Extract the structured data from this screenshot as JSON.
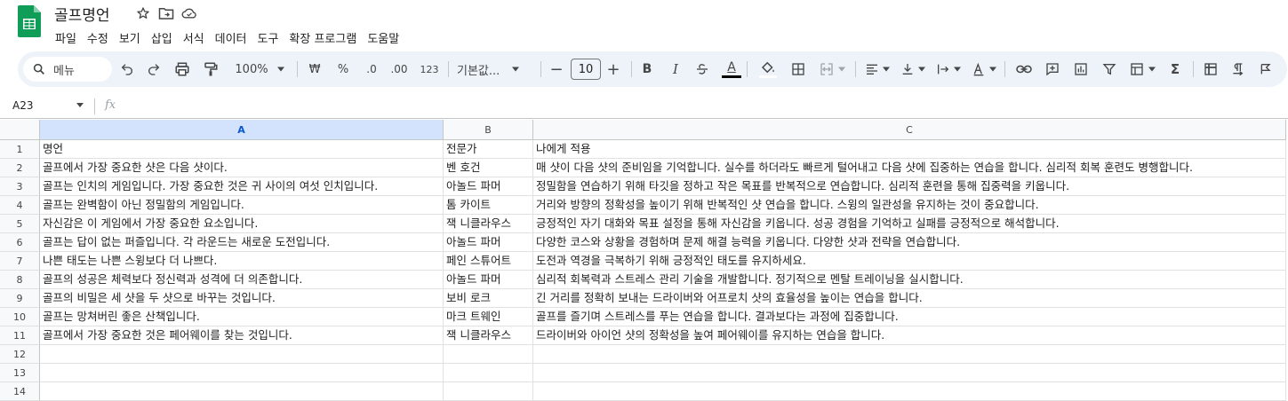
{
  "header": {
    "doc_title": "골프명언",
    "icons": [
      "star-icon",
      "move-to-folder-icon",
      "cloud-status-icon"
    ],
    "brand_color": "#0f9d58"
  },
  "menu": [
    "파일",
    "수정",
    "보기",
    "삽입",
    "서식",
    "데이터",
    "도구",
    "확장 프로그램",
    "도움말"
  ],
  "toolbar": {
    "search_label": "메뉴",
    "zoom": "100%",
    "currency": "₩",
    "percent": "%",
    "dec_decrease": ".0",
    "dec_increase": ".00",
    "number_format": "123",
    "font_name": "기본값...",
    "font_size": "10",
    "minus": "−",
    "plus": "+",
    "bold": "B",
    "italic": "I",
    "text_color": "A",
    "sum": "Σ"
  },
  "formula_bar": {
    "name_box": "A23",
    "fx": "fx"
  },
  "grid": {
    "columns": [
      "A",
      "B",
      "C"
    ],
    "selected_column": "A",
    "row_numbers": [
      "1",
      "2",
      "3",
      "4",
      "5",
      "6",
      "7",
      "8",
      "9",
      "10",
      "11",
      "12",
      "13",
      "14"
    ],
    "rows": [
      [
        "명언",
        "전문가",
        "나에게 적용"
      ],
      [
        "골프에서 가장 중요한 샷은 다음 샷이다.",
        "벤 호건",
        "매 샷이 다음 샷의 준비임을 기억합니다. 실수를 하더라도 빠르게 털어내고 다음 샷에 집중하는 연습을 합니다. 심리적 회복 훈련도 병행합니다."
      ],
      [
        "골프는 인치의 게임입니다. 가장 중요한 것은 귀 사이의 여섯 인치입니다.",
        "아놀드 파머",
        "정밀함을 연습하기 위해 타깃을 정하고 작은 목표를 반복적으로 연습합니다. 심리적 훈련을 통해 집중력을 키웁니다."
      ],
      [
        "골프는 완벽함이 아닌 정밀함의 게임입니다.",
        "톰 카이트",
        "거리와 방향의 정확성을 높이기 위해 반복적인 샷 연습을 합니다. 스윙의 일관성을 유지하는 것이 중요합니다."
      ],
      [
        "자신감은 이 게임에서 가장 중요한 요소입니다.",
        "잭 니클라우스",
        "긍정적인 자기 대화와 목표 설정을 통해 자신감을 키웁니다. 성공 경험을 기억하고 실패를 긍정적으로 해석합니다."
      ],
      [
        "골프는 답이 없는 퍼즐입니다. 각 라운드는 새로운 도전입니다.",
        "아놀드 파머",
        "다양한 코스와 상황을 경험하며 문제 해결 능력을 키웁니다. 다양한 샷과 전략을 연습합니다."
      ],
      [
        "나쁜 태도는 나쁜 스윙보다 더 나쁘다.",
        "페인 스튜어트",
        "도전과 역경을 극복하기 위해 긍정적인 태도를 유지하세요."
      ],
      [
        "골프의 성공은 체력보다 정신력과 성격에 더 의존합니다.",
        "아놀드 파머",
        "심리적 회복력과 스트레스 관리 기술을 개발합니다. 정기적으로 멘탈 트레이닝을 실시합니다."
      ],
      [
        "골프의 비밀은 세 샷을 두 샷으로 바꾸는 것입니다.",
        "보비 로크",
        "긴 거리를 정확히 보내는 드라이버와 어프로치 샷의 효율성을 높이는 연습을 합니다."
      ],
      [
        "골프는 망쳐버린 좋은 산책입니다.",
        "마크 트웨인",
        "골프를 즐기며 스트레스를 푸는 연습을 합니다. 결과보다는 과정에 집중합니다."
      ],
      [
        "골프에서 가장 중요한 것은 페어웨이를 찾는 것입니다.",
        "잭 니클라우스",
        "드라이버와 아이언 샷의 정확성을 높여 페어웨이를 유지하는 연습을 합니다."
      ],
      [
        "",
        "",
        ""
      ],
      [
        "",
        "",
        ""
      ],
      [
        "",
        "",
        ""
      ]
    ]
  }
}
